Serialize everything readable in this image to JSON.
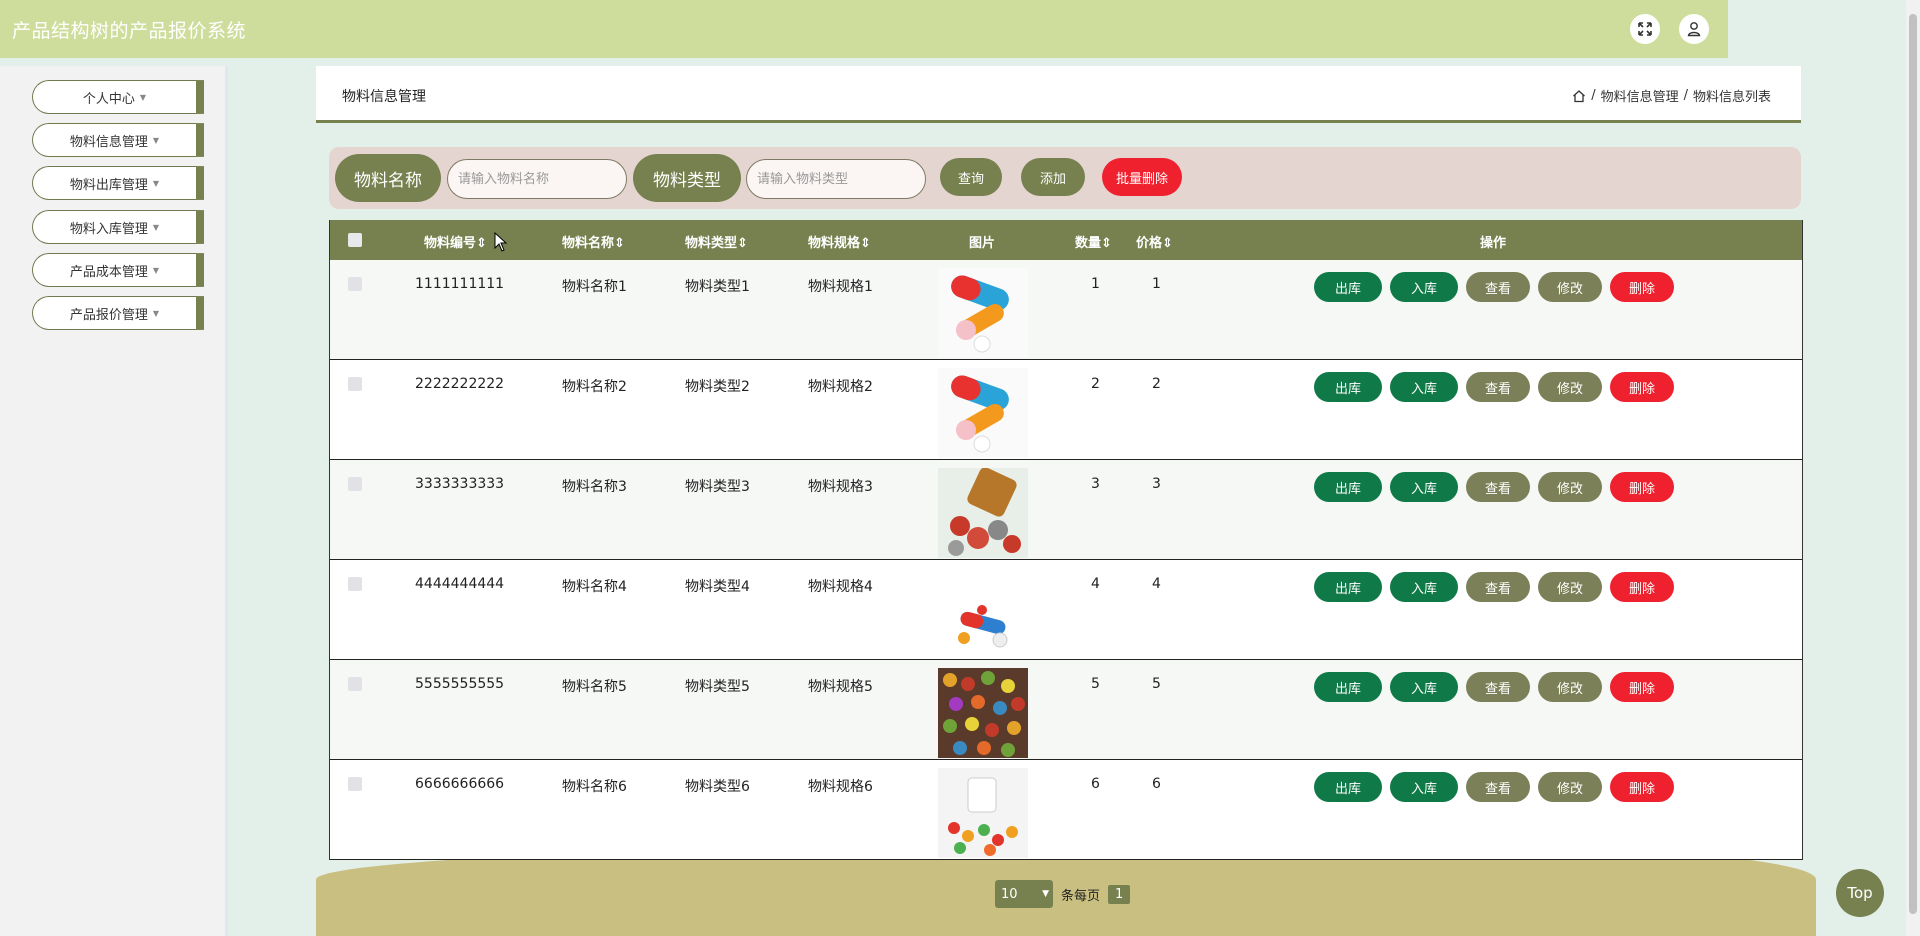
{
  "header": {
    "title": "产品结构树的产品报价系统",
    "fullscreen_icon": "expand-icon",
    "user_icon": "user-icon"
  },
  "sidebar": {
    "items": [
      {
        "label": "个人中心"
      },
      {
        "label": "物料信息管理"
      },
      {
        "label": "物料出库管理"
      },
      {
        "label": "物料入库管理"
      },
      {
        "label": "产品成本管理"
      },
      {
        "label": "产品报价管理"
      }
    ]
  },
  "page": {
    "title": "物料信息管理",
    "breadcrumb": [
      "物料信息管理",
      "物料信息列表"
    ],
    "separator": "/"
  },
  "search": {
    "name_label": "物料名称",
    "name_placeholder": "请输入物料名称",
    "type_label": "物料类型",
    "type_placeholder": "请输入物料类型",
    "query_label": "查询",
    "add_label": "添加",
    "batch_delete_label": "批量删除"
  },
  "table": {
    "columns": [
      "物料编号",
      "物料名称",
      "物料类型",
      "物料规格",
      "图片",
      "数量",
      "价格",
      "操作"
    ],
    "sort_glyph": "⇕",
    "actions": {
      "out": "出库",
      "in": "入库",
      "view": "查看",
      "edit": "修改",
      "delete": "删除"
    },
    "rows": [
      {
        "code": "1111111111",
        "name": "物料名称1",
        "type": "物料类型1",
        "spec": "物料规格1",
        "qty": "1",
        "price": "1"
      },
      {
        "code": "2222222222",
        "name": "物料名称2",
        "type": "物料类型2",
        "spec": "物料规格2",
        "qty": "2",
        "price": "2"
      },
      {
        "code": "3333333333",
        "name": "物料名称3",
        "type": "物料类型3",
        "spec": "物料规格3",
        "qty": "3",
        "price": "3"
      },
      {
        "code": "4444444444",
        "name": "物料名称4",
        "type": "物料类型4",
        "spec": "物料规格4",
        "qty": "4",
        "price": "4"
      },
      {
        "code": "5555555555",
        "name": "物料名称5",
        "type": "物料类型5",
        "spec": "物料规格5",
        "qty": "5",
        "price": "5"
      },
      {
        "code": "6666666666",
        "name": "物料名称6",
        "type": "物料类型6",
        "spec": "物料规格6",
        "qty": "6",
        "price": "6"
      }
    ]
  },
  "pager": {
    "page_size": "10",
    "per_page_label": "条每页",
    "current_page": "1"
  },
  "top_button": "Top",
  "colors": {
    "accent": "#76814f",
    "header": "#cfdd9c",
    "green_btn": "#0f7a47",
    "danger": "#f0212f"
  }
}
